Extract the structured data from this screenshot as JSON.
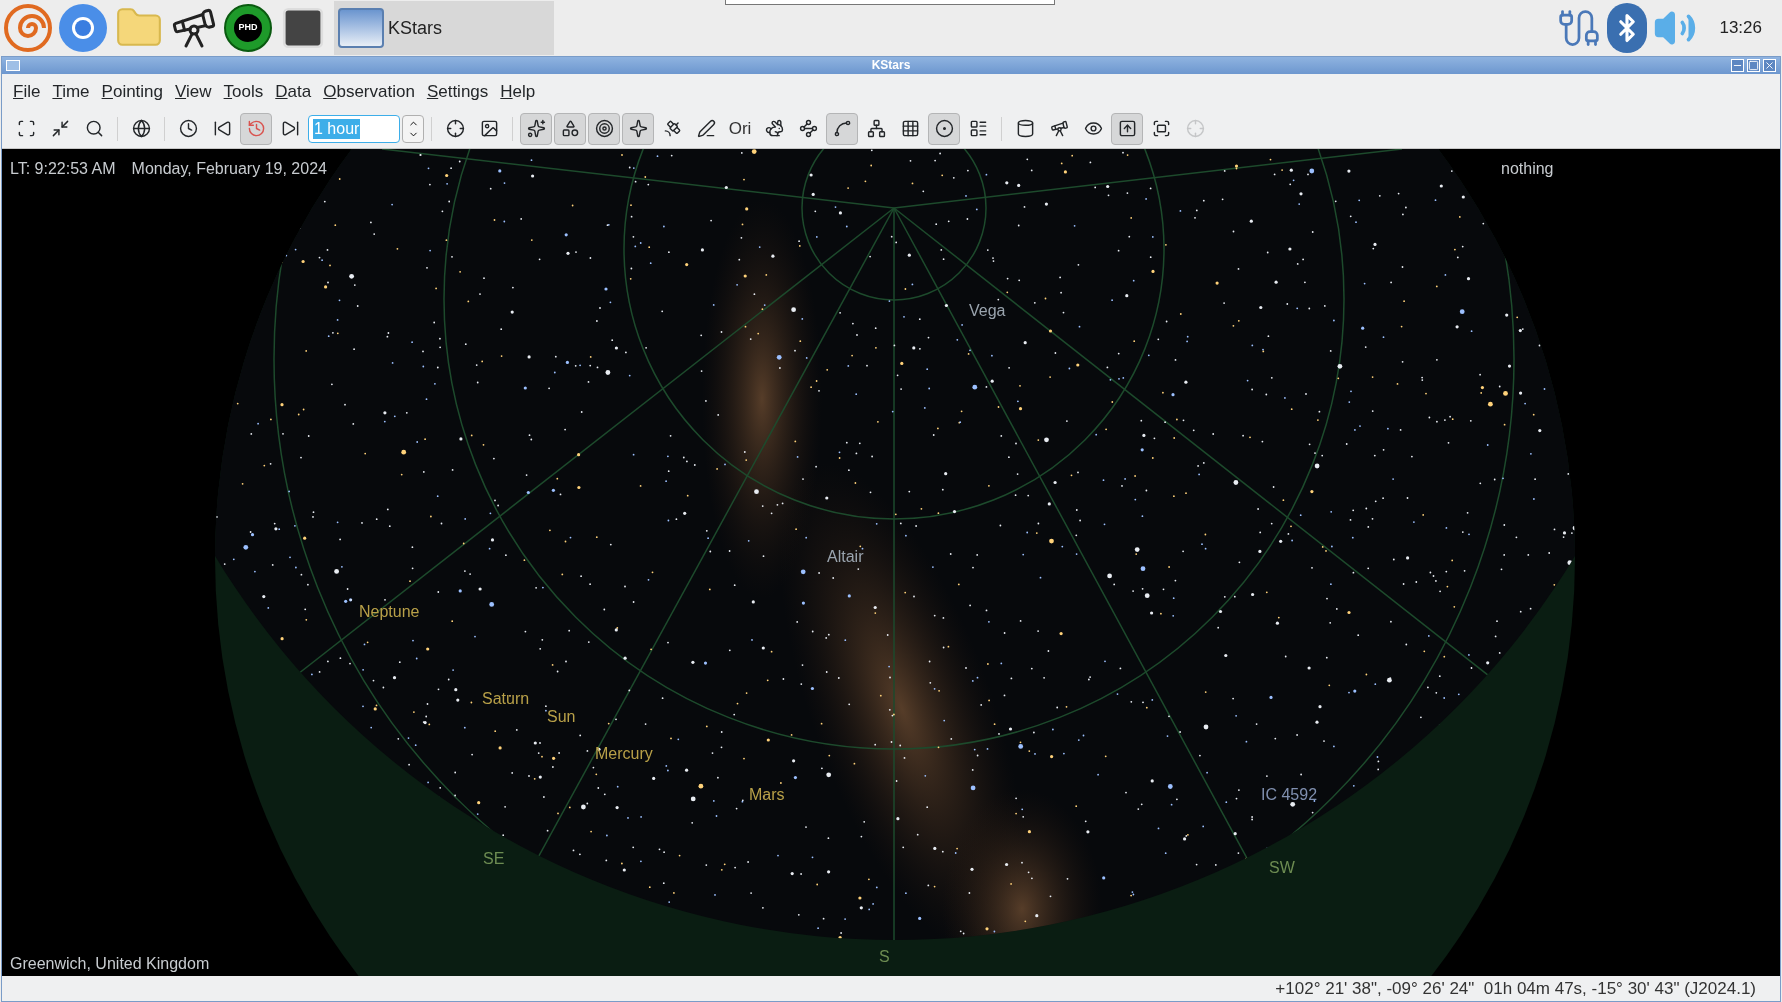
{
  "taskbar": {
    "phd_badge": "PHD",
    "task": {
      "label": "KStars",
      "selected": true
    },
    "clock": "13:26"
  },
  "window": {
    "title": "KStars"
  },
  "menu": [
    "File",
    "Time",
    "Pointing",
    "View",
    "Tools",
    "Data",
    "Observation",
    "Settings",
    "Help"
  ],
  "toolbar": [
    {
      "kind": "button",
      "pressed": false,
      "disabled": false
    },
    {
      "kind": "button",
      "pressed": false,
      "disabled": false
    },
    {
      "kind": "button",
      "pressed": false,
      "disabled": false
    },
    {
      "kind": "separator"
    },
    {
      "kind": "button",
      "pressed": false,
      "disabled": false
    },
    {
      "kind": "separator"
    },
    {
      "kind": "button",
      "pressed": false,
      "disabled": false
    },
    {
      "kind": "button",
      "pressed": false,
      "disabled": false
    },
    {
      "kind": "button",
      "pressed": true,
      "disabled": false
    },
    {
      "kind": "button",
      "pressed": false,
      "disabled": false
    },
    {
      "kind": "spin",
      "value": "1 hour"
    },
    {
      "kind": "separator"
    },
    {
      "kind": "button",
      "pressed": false,
      "disabled": false
    },
    {
      "kind": "button",
      "pressed": false,
      "disabled": false
    },
    {
      "kind": "separator"
    },
    {
      "kind": "button",
      "pressed": true,
      "disabled": false
    },
    {
      "kind": "button",
      "pressed": true,
      "disabled": false
    },
    {
      "kind": "button",
      "pressed": true,
      "disabled": false
    },
    {
      "kind": "button",
      "pressed": true,
      "disabled": false
    },
    {
      "kind": "button",
      "pressed": false,
      "disabled": false
    },
    {
      "kind": "button",
      "pressed": false,
      "disabled": false
    },
    {
      "kind": "text",
      "label": "Ori",
      "pressed": false
    },
    {
      "kind": "button",
      "pressed": false,
      "disabled": false
    },
    {
      "kind": "button",
      "pressed": false,
      "disabled": false
    },
    {
      "kind": "button",
      "pressed": true,
      "disabled": false
    },
    {
      "kind": "button",
      "pressed": false,
      "disabled": false
    },
    {
      "kind": "button",
      "pressed": false,
      "disabled": false
    },
    {
      "kind": "button",
      "pressed": true,
      "disabled": false
    },
    {
      "kind": "button",
      "pressed": false,
      "disabled": false
    },
    {
      "kind": "separator"
    },
    {
      "kind": "button",
      "pressed": false,
      "disabled": false
    },
    {
      "kind": "button",
      "pressed": false,
      "disabled": false
    },
    {
      "kind": "button",
      "pressed": false,
      "disabled": false
    },
    {
      "kind": "button",
      "pressed": true,
      "disabled": false
    },
    {
      "kind": "button",
      "pressed": false,
      "disabled": false
    },
    {
      "kind": "button",
      "pressed": false,
      "disabled": true
    }
  ],
  "sky": {
    "local_time": "LT: 9:22:53 AM",
    "date": "Monday, February 19, 2024",
    "focus": "nothing",
    "location": "Greenwich, United Kingdom",
    "labels": [
      {
        "text": "Vega",
        "kind": "star"
      },
      {
        "text": "Altair",
        "kind": "star"
      },
      {
        "text": "Neptune",
        "kind": "planet"
      },
      {
        "text": "Saturn",
        "kind": "planet"
      },
      {
        "text": "Sun",
        "kind": "planet"
      },
      {
        "text": "Mercury",
        "kind": "planet"
      },
      {
        "text": "Mars",
        "kind": "planet"
      },
      {
        "text": "IC 4592",
        "kind": "deepsky"
      },
      {
        "text": "SE",
        "kind": "compass"
      },
      {
        "text": "SW",
        "kind": "compass"
      },
      {
        "text": "S",
        "kind": "compass"
      }
    ]
  },
  "status_bar": {
    "coordinates": "+102° 21' 38\", -09° 26' 24\"  01h 04m 47s, -15° 30' 43\" (J2024.1)"
  }
}
